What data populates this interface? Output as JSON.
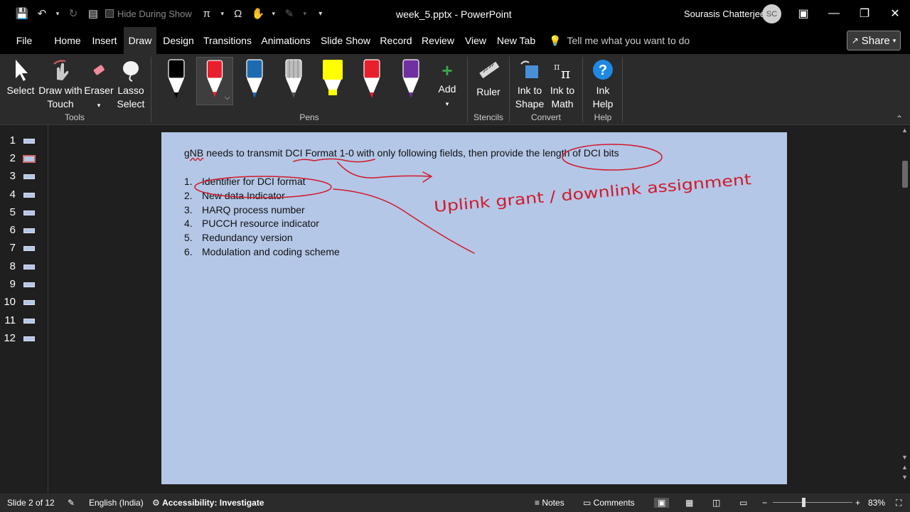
{
  "titlebar": {
    "hide_during_show": "Hide During Show",
    "doc_title": "week_5.pptx  -  PowerPoint",
    "user_name": "Sourasis Chatterjee",
    "user_initials": "SC"
  },
  "tabs": [
    "File",
    "Home",
    "Insert",
    "Draw",
    "Design",
    "Transitions",
    "Animations",
    "Slide Show",
    "Record",
    "Review",
    "View",
    "New Tab"
  ],
  "active_tab": "Draw",
  "tell_me": "Tell me what you want to do",
  "share_label": "Share",
  "ribbon": {
    "tools": {
      "select": "Select",
      "draw_touch_1": "Draw with",
      "draw_touch_2": "Touch",
      "eraser": "Eraser",
      "lasso_1": "Lasso",
      "lasso_2": "Select",
      "group": "Tools"
    },
    "pens": {
      "add": "Add",
      "group": "Pens",
      "colors": [
        "#000000",
        "#e8202e",
        "#1f6bb0",
        "#cfcfcf",
        "#ffff00",
        "#e8202e",
        "#7030a0"
      ]
    },
    "stencils": {
      "ruler": "Ruler",
      "group": "Stencils"
    },
    "convert": {
      "ink_shape_1": "Ink to",
      "ink_shape_2": "Shape",
      "ink_math_1": "Ink to",
      "ink_math_2": "Math",
      "group": "Convert"
    },
    "help": {
      "ink_help_1": "Ink",
      "ink_help_2": "Help",
      "group": "Help"
    }
  },
  "thumbnails": [
    "1",
    "2",
    "3",
    "4",
    "5",
    "6",
    "7",
    "8",
    "9",
    "10",
    "11",
    "12"
  ],
  "active_slide": 2,
  "slide": {
    "heading_parts": {
      "gnb": "gNB",
      "rest": " needs to transmit DCI Format 1-0 with only following fields, then provide the length of DCI bits"
    },
    "items": [
      {
        "num": "1.",
        "text": "Identifier for DCI format"
      },
      {
        "num": "2.",
        "text": "New data Indicator"
      },
      {
        "num": "3.",
        "text": "HARQ process number"
      },
      {
        "num": "4.",
        "text": "PUCCH resource indicator"
      },
      {
        "num": "5.",
        "text": "Redundancy version"
      },
      {
        "num": "6.",
        "text": "Modulation and coding scheme"
      }
    ],
    "handwriting": "Uplink grant / downlink assignment",
    "ink_color": "#d11a2a"
  },
  "status": {
    "slide_of": "Slide 2 of 12",
    "language": "English (India)",
    "accessibility": "Accessibility: Investigate",
    "notes": "Notes",
    "comments": "Comments",
    "zoom": "83%"
  }
}
